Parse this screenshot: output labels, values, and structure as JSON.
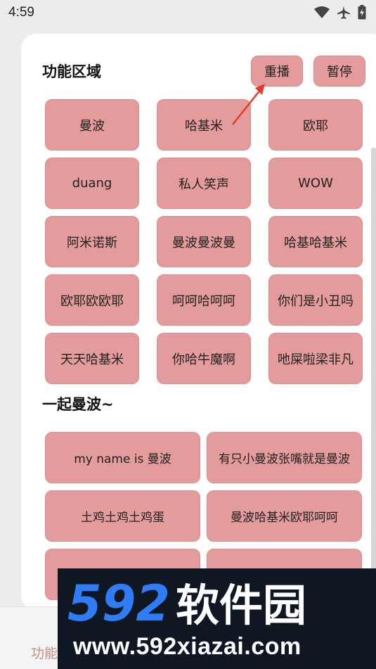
{
  "status_bar": {
    "time": "4:59",
    "icons": [
      "wifi-icon",
      "airplane-icon",
      "battery-charging-icon"
    ]
  },
  "function_area": {
    "title": "功能区域",
    "replay_label": "重播",
    "pause_label": "暂停",
    "buttons": [
      "曼波",
      "哈基米",
      "欧耶",
      "duang",
      "私人笑声",
      "WOW",
      "阿米诺斯",
      "曼波曼波曼",
      "哈基哈基米",
      "欧耶欧欧耶",
      "呵呵哈呵呵",
      "你们是小丑吗",
      "天天哈基米",
      "你哈牛魔啊",
      "吔屎啦梁非凡"
    ]
  },
  "together": {
    "title": "一起曼波~",
    "buttons": [
      "my name is 曼波",
      "有只小曼波张嘴就是曼波",
      "土鸡土鸡土鸡蛋",
      "曼波哈基米欧耶呵呵"
    ]
  },
  "bottom_nav": {
    "label": "功能"
  },
  "watermark": {
    "logo_text": "592软件园",
    "url": "www.592xiazai.com"
  },
  "colors": {
    "button_bg": "#e49b9b",
    "arrow": "#e23b2e",
    "card_bg": "#ffffff",
    "page_bg": "#ececec",
    "watermark_blue": "#2f7cf6"
  }
}
